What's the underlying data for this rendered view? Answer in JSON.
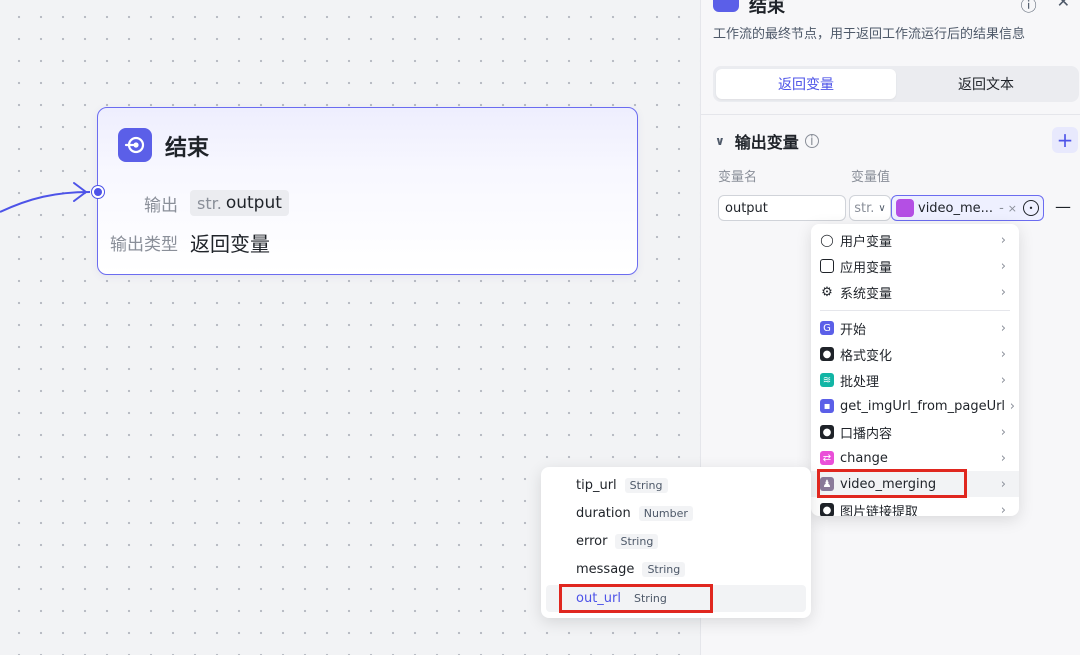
{
  "node": {
    "title": "结束",
    "output_label": "输出",
    "output_prefix": "str.",
    "output_name": "output",
    "type_label": "输出类型",
    "type_value": "返回变量"
  },
  "panel": {
    "title": "结束",
    "description": "工作流的最终节点，用于返回工作流运行后的结果信息",
    "tabs": [
      {
        "label": "返回变量",
        "active": true
      },
      {
        "label": "返回文本",
        "active": false
      }
    ],
    "section_title": "输出变量",
    "col_name": "变量名",
    "col_value": "变量值",
    "row": {
      "name": "output",
      "type": "str.",
      "ref_text": "video_me...",
      "ref_sep": "-",
      "ref_clear": "×"
    }
  },
  "dropdown": {
    "items": [
      {
        "label": "用户变量",
        "icon": "user-icon"
      },
      {
        "label": "应用变量",
        "icon": "square-icon"
      },
      {
        "label": "系统变量",
        "icon": "gear-icon"
      },
      {
        "label": "开始",
        "icon": "start-icon",
        "color": "#5b5fe8"
      },
      {
        "label": "格式变化",
        "icon": "plugin-icon",
        "color": "#1f2329"
      },
      {
        "label": "批处理",
        "icon": "batch-icon",
        "color": "#12b5a5"
      },
      {
        "label": "get_imgUrl_from_pageUrl",
        "icon": "code-icon",
        "color": "#5b5fe8"
      },
      {
        "label": "口播内容",
        "icon": "plugin-icon",
        "color": "#1f2329"
      },
      {
        "label": "change",
        "icon": "change-icon",
        "color": "#ea4fd8"
      },
      {
        "label": "video_merging",
        "icon": "avatar-icon",
        "color": "#8a7a9a"
      },
      {
        "label": "图片链接提取",
        "icon": "plugin-icon",
        "color": "#1f2329"
      }
    ]
  },
  "subdrop": {
    "items": [
      {
        "name": "tip_url",
        "type": "String"
      },
      {
        "name": "duration",
        "type": "Number"
      },
      {
        "name": "error",
        "type": "String"
      },
      {
        "name": "message",
        "type": "String"
      },
      {
        "name": "out_url",
        "type": "String"
      }
    ]
  }
}
